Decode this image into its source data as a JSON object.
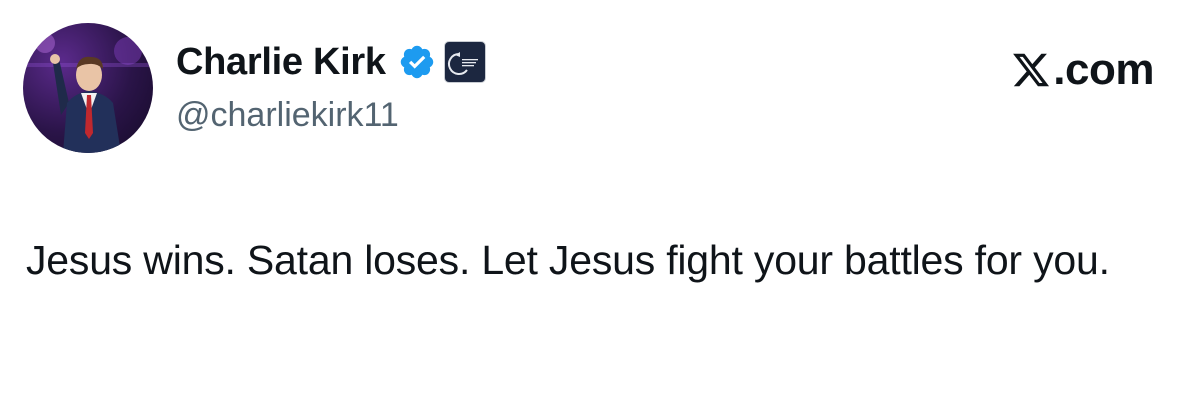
{
  "author": {
    "display_name": "Charlie Kirk",
    "handle": "@charliekirk11",
    "verified": true,
    "verified_color": "#1d9bf0",
    "affiliation_badge": "turning-point-usa-badge",
    "affiliation_text": "TURNING POINT USA"
  },
  "brand": {
    "icon": "x-logo-icon",
    "label": ".com"
  },
  "tweet": {
    "text": "Jesus wins. Satan loses. Let Jesus fight your battles for you."
  },
  "colors": {
    "text_primary": "#0f1419",
    "text_secondary": "#536471",
    "background": "#ffffff"
  }
}
